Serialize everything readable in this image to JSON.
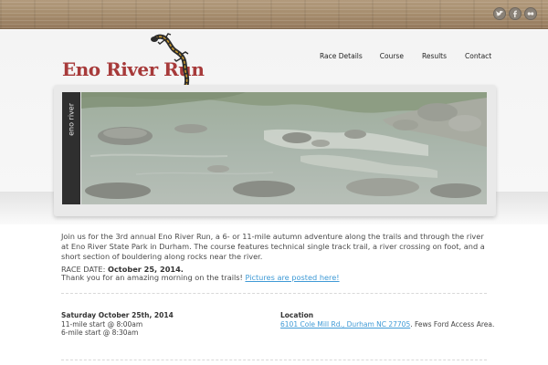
{
  "site": {
    "title": "Eno River Run",
    "social": [
      "twitter-icon",
      "facebook-icon",
      "flickr-icon"
    ]
  },
  "nav": {
    "items": [
      "Race Details",
      "Course",
      "Results",
      "Contact"
    ]
  },
  "slideshow": {
    "caption": "eno river"
  },
  "content": {
    "intro": "Join us for the 3rd annual Eno River Run, a 6- or 11-mile autumn adventure along the trails and through the river at Eno River State Park in Durham. The course features technical single track trail, a river crossing on foot, and a short section of bouldering along rocks near the river.",
    "race_date_label": "RACE DATE:",
    "race_date_value": "October 25, 2014.",
    "thanks_text": "Thank you for an amazing morning on the trails!",
    "thanks_link": "Pictures are posted here!"
  },
  "schedule": {
    "heading": "Saturday October 25th, 2014",
    "lines": [
      "11-mile start @ 8:00am",
      "6-mile start @ 8:30am"
    ]
  },
  "location": {
    "heading": "Location",
    "address_link": "6101 Cole Mill Rd., Durham NC 27705",
    "address_rest": ". Fews Ford Access Area."
  },
  "colors": {
    "brand": "#a73a3a",
    "link": "#3f9ad6"
  }
}
